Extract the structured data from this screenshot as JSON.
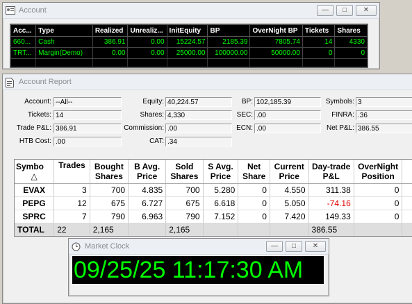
{
  "account_window": {
    "title": "Account",
    "columns": [
      "Acc...",
      "Type",
      "Realized",
      "Unrealiz...",
      "InitEquity",
      "BP",
      "OverNight BP",
      "Tickets",
      "Shares"
    ],
    "rows": [
      [
        "660...",
        "Cash",
        "386.91",
        "0.00",
        "15224.57",
        "2185.39",
        "7805.74",
        "14",
        "4330"
      ],
      [
        "TRT...",
        "Margin(Demo)",
        "0.00",
        "0.00",
        "25000.00",
        "100000.00",
        "50000.00",
        "0",
        "0"
      ]
    ]
  },
  "report_window": {
    "title": "Account Report",
    "fields": {
      "account_label": "Account:",
      "account_value": "--All--",
      "tickets_label": "Tickets:",
      "tickets_value": "14",
      "tradepl_label": "Trade P&L:",
      "tradepl_value": "386.91",
      "htbcost_label": "HTB Cost:",
      "htbcost_value": ".00",
      "equity_label": "Equity:",
      "equity_value": "40,224.57",
      "shares_label": "Shares:",
      "shares_value": "4,330",
      "commission_label": "Commission:",
      "commission_value": ".00",
      "cat_label": "CAT:",
      "cat_value": ".34",
      "bp_label": "BP:",
      "bp_value": "102,185.39",
      "sec_label": "SEC:",
      "sec_value": ".00",
      "ecn_label": "ECN:",
      "ecn_value": ".00",
      "symbols_label": "Symbols:",
      "symbols_value": "3",
      "finra_label": "FINRA:",
      "finra_value": ".36",
      "netpl_label": "Net P&L:",
      "netpl_value": "386.55"
    },
    "table": {
      "headers": {
        "symbol": "Symbo",
        "trades": "Trades",
        "bought_l1": "Bought",
        "bought_l2": "Shares",
        "bavg_l1": "B Avg.",
        "bavg_l2": "Price",
        "sold_l1": "Sold",
        "sold_l2": "Shares",
        "savg_l1": "S Avg.",
        "savg_l2": "Price",
        "net_l1": "Net",
        "net_l2": "Share",
        "cur_l1": "Current",
        "cur_l2": "Price",
        "dt_l1": "Day-trade",
        "dt_l2": "P&L",
        "on_l1": "OverNight",
        "on_l2": "Position",
        "sort_arrow": "△"
      },
      "rows": [
        {
          "symbol": "EVAX",
          "trades": "3",
          "bought": "700",
          "bavg": "4.835",
          "sold": "700",
          "savg": "5.280",
          "net": "0",
          "cur": "4.550",
          "dtpl": "311.38",
          "on": "0"
        },
        {
          "symbol": "PEPG",
          "trades": "12",
          "bought": "675",
          "bavg": "6.727",
          "sold": "675",
          "savg": "6.618",
          "net": "0",
          "cur": "5.050",
          "dtpl": "-74.16",
          "on": "0"
        },
        {
          "symbol": "SPRC",
          "trades": "7",
          "bought": "790",
          "bavg": "6.963",
          "sold": "790",
          "savg": "7.152",
          "net": "0",
          "cur": "7.420",
          "dtpl": "149.33",
          "on": "0"
        }
      ],
      "total": {
        "label": "TOTAL",
        "trades": "22",
        "bought": "2,165",
        "sold": "2,165",
        "dtpl": "386.55"
      }
    }
  },
  "clock_window": {
    "title": "Market Clock",
    "time": "09/25/25 11:17:30 AM"
  },
  "colors": {
    "grid_text": "#00ff00",
    "negative": "#e00000",
    "clock_text": "#00ff00"
  }
}
